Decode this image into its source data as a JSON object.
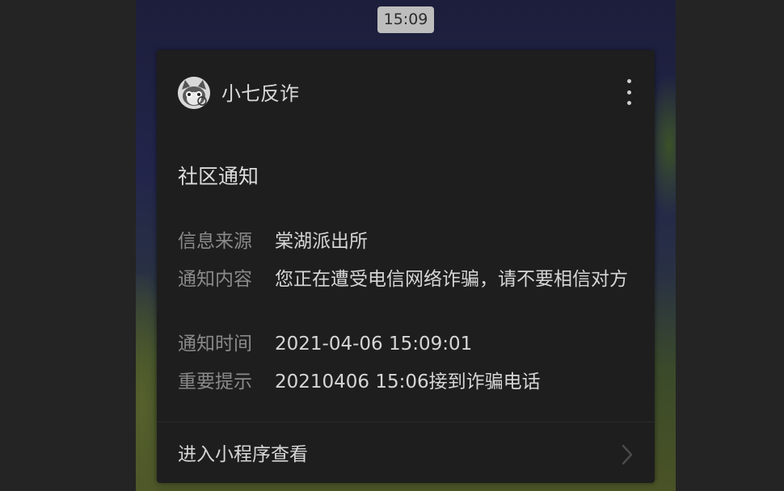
{
  "status_bar": {
    "time": "15:09"
  },
  "card": {
    "account_name": "小七反诈",
    "avatar_icon": "cat-mascot-avatar-icon",
    "more_icon": "more-vertical-icon",
    "title": "社区通知",
    "fields": {
      "source": {
        "label": "信息来源",
        "value": "棠湖派出所"
      },
      "content": {
        "label": "通知内容",
        "value": "您正在遭受电信网络诈骗，请不要相信对方"
      },
      "time": {
        "label": "通知时间",
        "value": "2021-04-06 15:09:01"
      },
      "tip": {
        "label": "重要提示",
        "value": "20210406 15:06接到诈骗电话"
      }
    },
    "footer": {
      "label": "进入小程序查看",
      "icon": "chevron-right-icon"
    }
  },
  "colors": {
    "card_background": "#1e1e1e",
    "label_text": "#8a8a8a",
    "value_text": "#d6d6d6",
    "time_pill": "#bdbdbd"
  }
}
